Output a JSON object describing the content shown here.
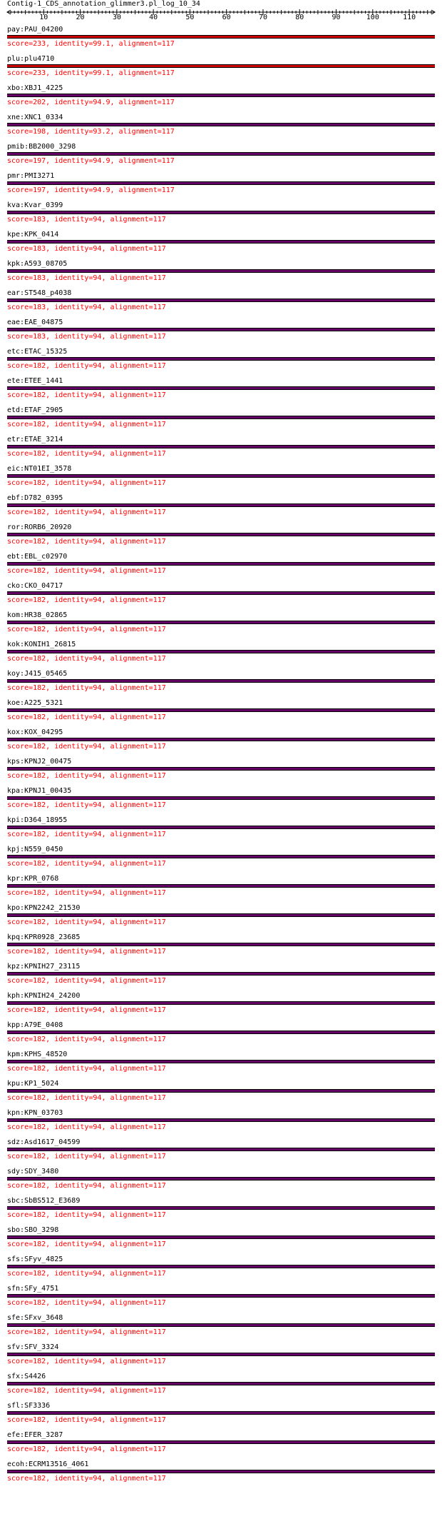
{
  "title": "Contig-1_CDS_annotation_glimmer3.pl_log_10_34",
  "ruler": {
    "ticks": [
      10,
      20,
      30,
      40,
      50,
      60,
      70,
      80,
      90,
      100,
      110
    ],
    "max": 117
  },
  "colors": {
    "score_text": "#ff0000",
    "bar_high": "#cc0000",
    "bar_low": "#660066",
    "bar_border": "#000000"
  },
  "hits": [
    {
      "name": "pay:PAU_04200",
      "score": "score=233, identity=99.1, alignment=117",
      "level": "high"
    },
    {
      "name": "plu:plu4710",
      "score": "score=233, identity=99.1, alignment=117",
      "level": "high"
    },
    {
      "name": "xbo:XBJ1_4225",
      "score": "score=202, identity=94.9, alignment=117",
      "level": "low"
    },
    {
      "name": "xne:XNC1_0334",
      "score": "score=198, identity=93.2, alignment=117",
      "level": "low"
    },
    {
      "name": "pmib:BB2000_3298",
      "score": "score=197, identity=94.9, alignment=117",
      "level": "low"
    },
    {
      "name": "pmr:PMI3271",
      "score": "score=197, identity=94.9, alignment=117",
      "level": "low"
    },
    {
      "name": "kva:Kvar_0399",
      "score": "score=183, identity=94, alignment=117",
      "level": "low"
    },
    {
      "name": "kpe:KPK_0414",
      "score": "score=183, identity=94, alignment=117",
      "level": "low"
    },
    {
      "name": "kpk:A593_08705",
      "score": "score=183, identity=94, alignment=117",
      "level": "low"
    },
    {
      "name": "ear:ST548_p4038",
      "score": "score=183, identity=94, alignment=117",
      "level": "low"
    },
    {
      "name": "eae:EAE_04875",
      "score": "score=183, identity=94, alignment=117",
      "level": "low"
    },
    {
      "name": "etc:ETAC_15325",
      "score": "score=182, identity=94, alignment=117",
      "level": "low"
    },
    {
      "name": "ete:ETEE_1441",
      "score": "score=182, identity=94, alignment=117",
      "level": "low"
    },
    {
      "name": "etd:ETAF_2905",
      "score": "score=182, identity=94, alignment=117",
      "level": "low"
    },
    {
      "name": "etr:ETAE_3214",
      "score": "score=182, identity=94, alignment=117",
      "level": "low"
    },
    {
      "name": "eic:NT01EI_3578",
      "score": "score=182, identity=94, alignment=117",
      "level": "low"
    },
    {
      "name": "ebf:D782_0395",
      "score": "score=182, identity=94, alignment=117",
      "level": "low"
    },
    {
      "name": "ror:RORB6_20920",
      "score": "score=182, identity=94, alignment=117",
      "level": "low"
    },
    {
      "name": "ebt:EBL_c02970",
      "score": "score=182, identity=94, alignment=117",
      "level": "low"
    },
    {
      "name": "cko:CKO_04717",
      "score": "score=182, identity=94, alignment=117",
      "level": "low"
    },
    {
      "name": "kom:HR38_02865",
      "score": "score=182, identity=94, alignment=117",
      "level": "low"
    },
    {
      "name": "kok:KONIH1_26815",
      "score": "score=182, identity=94, alignment=117",
      "level": "low"
    },
    {
      "name": "koy:J415_05465",
      "score": "score=182, identity=94, alignment=117",
      "level": "low"
    },
    {
      "name": "koe:A225_5321",
      "score": "score=182, identity=94, alignment=117",
      "level": "low"
    },
    {
      "name": "kox:KOX_04295",
      "score": "score=182, identity=94, alignment=117",
      "level": "low"
    },
    {
      "name": "kps:KPNJ2_00475",
      "score": "score=182, identity=94, alignment=117",
      "level": "low"
    },
    {
      "name": "kpa:KPNJ1_00435",
      "score": "score=182, identity=94, alignment=117",
      "level": "low"
    },
    {
      "name": "kpi:D364_18955",
      "score": "score=182, identity=94, alignment=117",
      "level": "low"
    },
    {
      "name": "kpj:N559_0450",
      "score": "score=182, identity=94, alignment=117",
      "level": "low"
    },
    {
      "name": "kpr:KPR_0768",
      "score": "score=182, identity=94, alignment=117",
      "level": "low"
    },
    {
      "name": "kpo:KPN2242_21530",
      "score": "score=182, identity=94, alignment=117",
      "level": "low"
    },
    {
      "name": "kpq:KPR0928_23685",
      "score": "score=182, identity=94, alignment=117",
      "level": "low"
    },
    {
      "name": "kpz:KPNIH27_23115",
      "score": "score=182, identity=94, alignment=117",
      "level": "low"
    },
    {
      "name": "kph:KPNIH24_24200",
      "score": "score=182, identity=94, alignment=117",
      "level": "low"
    },
    {
      "name": "kpp:A79E_0408",
      "score": "score=182, identity=94, alignment=117",
      "level": "low"
    },
    {
      "name": "kpm:KPHS_48520",
      "score": "score=182, identity=94, alignment=117",
      "level": "low"
    },
    {
      "name": "kpu:KP1_5024",
      "score": "score=182, identity=94, alignment=117",
      "level": "low"
    },
    {
      "name": "kpn:KPN_03703",
      "score": "score=182, identity=94, alignment=117",
      "level": "low"
    },
    {
      "name": "sdz:Asd1617_04599",
      "score": "score=182, identity=94, alignment=117",
      "level": "low"
    },
    {
      "name": "sdy:SDY_3480",
      "score": "score=182, identity=94, alignment=117",
      "level": "low"
    },
    {
      "name": "sbc:SbBS512_E3689",
      "score": "score=182, identity=94, alignment=117",
      "level": "low"
    },
    {
      "name": "sbo:SBO_3298",
      "score": "score=182, identity=94, alignment=117",
      "level": "low"
    },
    {
      "name": "sfs:SFyv_4825",
      "score": "score=182, identity=94, alignment=117",
      "level": "low"
    },
    {
      "name": "sfn:SFy_4751",
      "score": "score=182, identity=94, alignment=117",
      "level": "low"
    },
    {
      "name": "sfe:SFxv_3648",
      "score": "score=182, identity=94, alignment=117",
      "level": "low"
    },
    {
      "name": "sfv:SFV_3324",
      "score": "score=182, identity=94, alignment=117",
      "level": "low"
    },
    {
      "name": "sfx:S4426",
      "score": "score=182, identity=94, alignment=117",
      "level": "low"
    },
    {
      "name": "sfl:SF3336",
      "score": "score=182, identity=94, alignment=117",
      "level": "low"
    },
    {
      "name": "efe:EFER_3287",
      "score": "score=182, identity=94, alignment=117",
      "level": "low"
    },
    {
      "name": "ecoh:ECRM13516_4061",
      "score": "score=182, identity=94, alignment=117",
      "level": "low"
    }
  ]
}
